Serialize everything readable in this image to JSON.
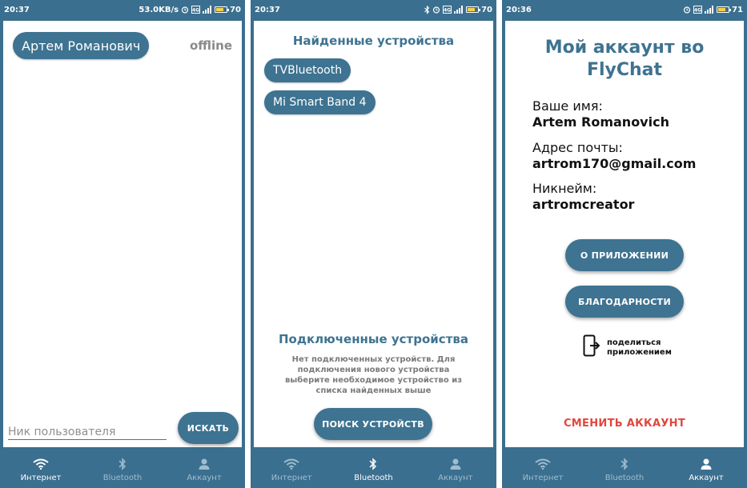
{
  "colors": {
    "primary": "#3e7391",
    "frame": "#3b6f8f",
    "accent_red": "#e0473d",
    "battery": "#f5d34a"
  },
  "nav": {
    "items": [
      {
        "label": "Интернет",
        "icon": "wifi-icon"
      },
      {
        "label": "Bluetooth",
        "icon": "bluetooth-icon"
      },
      {
        "label": "Аккаунт",
        "icon": "person-icon"
      }
    ]
  },
  "screen1": {
    "status": {
      "time": "20:37",
      "speed": "53.0KB/s",
      "battery": "70"
    },
    "active_tab": 0,
    "user_pill": "Артем Романович",
    "status_text": "offline",
    "search_placeholder": "Ник пользователя",
    "search_value": "",
    "search_button": "ИСКАТЬ"
  },
  "screen2": {
    "status": {
      "time": "20:37",
      "battery": "70"
    },
    "active_tab": 1,
    "found_title": "Найденные устройства",
    "found_devices": [
      "TVBluetooth",
      "Mi Smart Band 4"
    ],
    "connected_title": "Подключенные устройства",
    "connected_note": "Нет подключенных устройств. Для подключения нового устройства выберите необходимое устройство из списка найденных выше",
    "search_devices_button": "ПОИСК УСТРОЙСТВ"
  },
  "screen3": {
    "status": {
      "time": "20:36",
      "battery": "71"
    },
    "active_tab": 2,
    "title_line1": "Мой аккаунт во",
    "title_line2": "FlyChat",
    "name_label": "Ваше имя:",
    "name_value": "Artem Romanovich",
    "email_label": "Адрес почты:",
    "email_value": "artrom170@gmail.com",
    "nick_label": "Никнейм:",
    "nick_value": "artromcreator",
    "about_button": "О ПРИЛОЖЕНИИ",
    "thanks_button": "БЛАГОДАРНОСТИ",
    "share_label": "поделиться приложением",
    "switch_account": "СМЕНИТЬ АККАУНТ"
  }
}
